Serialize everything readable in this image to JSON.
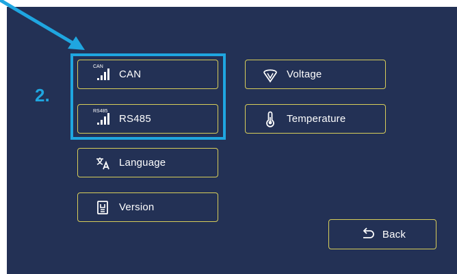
{
  "annotation": {
    "step_label": "2.",
    "highlight_color": "#1fa6e0"
  },
  "theme": {
    "screen_bg": "#233155",
    "button_border": "#d9cf5a",
    "text": "#ffffff"
  },
  "menu": {
    "can": {
      "label": "CAN",
      "icon": "signal-bars-icon",
      "icon_tag": "CAN"
    },
    "rs485": {
      "label": "RS485",
      "icon": "signal-bars-icon",
      "icon_tag": "RS485"
    },
    "language": {
      "label": "Language",
      "icon": "translate-icon"
    },
    "version": {
      "label": "Version",
      "icon": "document-icon"
    },
    "voltage": {
      "label": "Voltage",
      "icon": "voltage-gauge-icon"
    },
    "temperature": {
      "label": "Temperature",
      "icon": "thermometer-icon"
    },
    "back": {
      "label": "Back",
      "icon": "back-arrow-icon"
    }
  }
}
